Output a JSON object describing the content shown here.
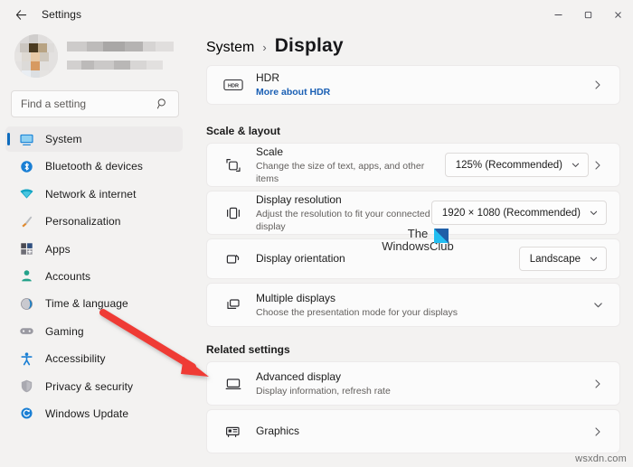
{
  "window": {
    "title": "Settings",
    "back_icon": "back-arrow-icon",
    "controls": {
      "minimize": "minimize-icon",
      "maximize": "maximize-icon",
      "close": "close-icon"
    }
  },
  "sidebar": {
    "search": {
      "placeholder": "Find a setting",
      "icon": "search-icon"
    },
    "items": [
      {
        "label": "System",
        "icon": "monitor-icon",
        "color": "#2288d8",
        "selected": true
      },
      {
        "label": "Bluetooth & devices",
        "icon": "bluetooth-icon",
        "color": "#1a7fd4",
        "selected": false
      },
      {
        "label": "Network & internet",
        "icon": "wifi-icon",
        "color": "#14a5c4",
        "selected": false
      },
      {
        "label": "Personalization",
        "icon": "paintbrush-icon",
        "color": "#e08a2e",
        "selected": false
      },
      {
        "label": "Apps",
        "icon": "apps-icon",
        "color": "#2f4f7f",
        "selected": false
      },
      {
        "label": "Accounts",
        "icon": "person-icon",
        "color": "#24a28a",
        "selected": false
      },
      {
        "label": "Time & language",
        "icon": "clock-globe-icon",
        "color": "#1d7fc4",
        "selected": false
      },
      {
        "label": "Gaming",
        "icon": "gamepad-icon",
        "color": "#8d8d93",
        "selected": false
      },
      {
        "label": "Accessibility",
        "icon": "accessibility-icon",
        "color": "#1a7fd4",
        "selected": false
      },
      {
        "label": "Privacy & security",
        "icon": "shield-icon",
        "color": "#9a9aa0",
        "selected": false
      },
      {
        "label": "Windows Update",
        "icon": "update-icon",
        "color": "#1a7fd4",
        "selected": false
      }
    ]
  },
  "main": {
    "breadcrumb": {
      "parent": "System",
      "separator": "›",
      "current": "Display"
    },
    "hdr_card": {
      "icon": "hdr-icon",
      "title": "HDR",
      "link": "More about HDR",
      "chevron": "chevron-right-icon"
    },
    "scale_layout": {
      "heading": "Scale & layout",
      "scale": {
        "icon": "scale-icon",
        "title": "Scale",
        "subtitle": "Change the size of text, apps, and other items",
        "value": "125% (Recommended)",
        "dropdown_icon": "chevron-down-icon",
        "chevron": "chevron-right-icon"
      },
      "resolution": {
        "icon": "resolution-icon",
        "title": "Display resolution",
        "subtitle": "Adjust the resolution to fit your connected display",
        "value": "1920 × 1080 (Recommended)",
        "dropdown_icon": "chevron-down-icon"
      },
      "orientation": {
        "icon": "orientation-icon",
        "title": "Display orientation",
        "value": "Landscape",
        "dropdown_icon": "chevron-down-icon"
      },
      "multiple_displays": {
        "icon": "multiple-displays-icon",
        "title": "Multiple displays",
        "subtitle": "Choose the presentation mode for your displays",
        "chevron": "chevron-down-icon"
      }
    },
    "related_settings": {
      "heading": "Related settings",
      "advanced_display": {
        "icon": "monitor-outline-icon",
        "title": "Advanced display",
        "subtitle": "Display information, refresh rate",
        "chevron": "chevron-right-icon"
      },
      "graphics": {
        "icon": "graphics-card-icon",
        "title": "Graphics",
        "chevron": "chevron-right-icon"
      }
    }
  },
  "watermarks": {
    "brand_line1": "The",
    "brand_line2": "WindowsClub",
    "site": "wsxdn.com"
  },
  "annotation": {
    "arrow_color": "#ef3b36"
  }
}
